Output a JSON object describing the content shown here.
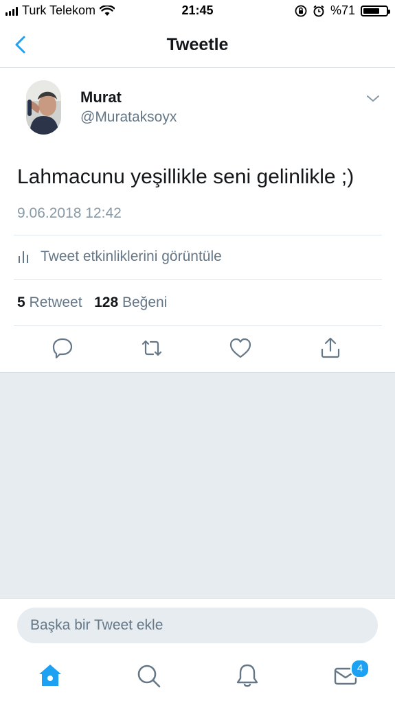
{
  "status_bar": {
    "carrier": "Turk Telekom",
    "time": "21:45",
    "battery_text": "%71",
    "battery_level": 0.71
  },
  "nav": {
    "title": "Tweetle",
    "back_icon": "chevron-left-icon"
  },
  "tweet": {
    "author_name": "Murat",
    "author_handle": "@Murataksoyx",
    "text": "Lahmacunu yeşillikle seni gelinlikle ;)",
    "timestamp": "9.06.2018 12:42",
    "analytics_label": "Tweet etkinliklerini görüntüle",
    "retweet_count": "5",
    "retweet_label": "Retweet",
    "like_count": "128",
    "like_label": "Beğeni"
  },
  "actions": [
    "reply-icon",
    "retweet-icon",
    "like-icon",
    "share-icon"
  ],
  "compose": {
    "placeholder": "Başka bir Tweet ekle"
  },
  "tab_bar": {
    "items": [
      "home-icon",
      "search-icon",
      "notifications-icon",
      "messages-icon"
    ],
    "messages_badge": "4"
  },
  "colors": {
    "accent": "#1da1f2",
    "secondary_text": "#657786",
    "background_gray": "#e6ecf0"
  }
}
